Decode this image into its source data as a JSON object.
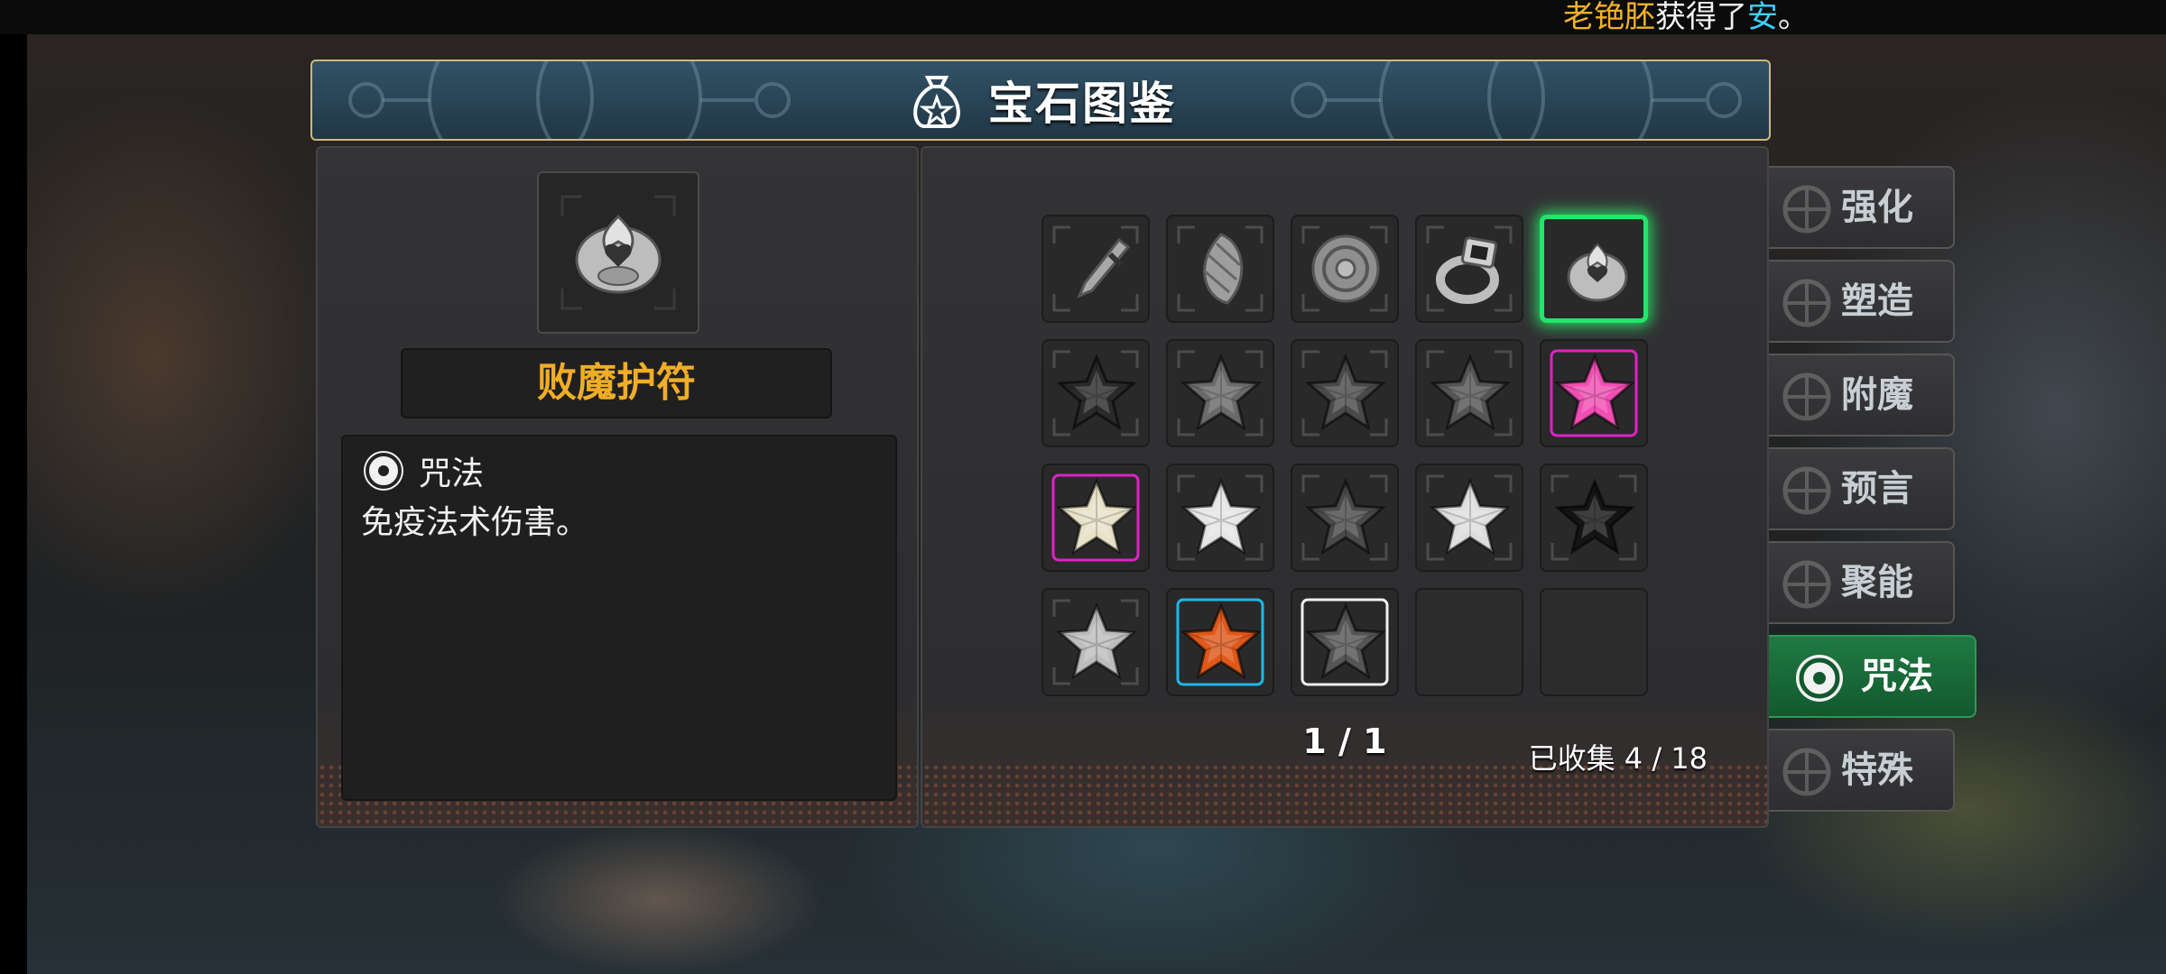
{
  "notice": {
    "player": "老铯胚",
    "action": "获得了",
    "item": "安",
    "end": "。"
  },
  "header": {
    "title": "宝石图鉴",
    "icon": "bag-star-icon"
  },
  "detail": {
    "name": "败魔护符",
    "type": "咒法",
    "type_icon": "spiral-icon",
    "description": "免疫法术伤害。"
  },
  "grid": {
    "page": "1 / 1",
    "collected": "已收集 4 / 18",
    "slots": [
      {
        "icon": "dagger-icon",
        "state": "owned"
      },
      {
        "icon": "scale-icon",
        "state": "owned"
      },
      {
        "icon": "shield-icon",
        "state": "owned"
      },
      {
        "icon": "ring-icon",
        "state": "owned"
      },
      {
        "icon": "amulet-icon",
        "state": "selected"
      },
      {
        "icon": "star-gem-icon",
        "color": "#2a2a2a",
        "frame": "#555555"
      },
      {
        "icon": "star-gem-icon",
        "color": "#6a6a6a",
        "frame": "#555555"
      },
      {
        "icon": "star-gem-icon",
        "color": "#4a4a4a",
        "frame": "#555555"
      },
      {
        "icon": "star-gem-icon",
        "color": "#555555",
        "frame": "#555555"
      },
      {
        "icon": "star-gem-icon",
        "color": "#f14fb4",
        "frame": "#e021c8"
      },
      {
        "icon": "star-gem-icon",
        "color": "#e8e2c8",
        "frame": "#e021c8"
      },
      {
        "icon": "star-gem-icon",
        "color": "#e6e6e6",
        "frame": "#555555"
      },
      {
        "icon": "star-gem-icon",
        "color": "#4a4a4a",
        "frame": "#555555"
      },
      {
        "icon": "star-gem-icon",
        "color": "#dedede",
        "frame": "#555555"
      },
      {
        "icon": "star-gem-icon",
        "color": "#151515",
        "frame": "#555555"
      },
      {
        "icon": "star-gem-icon",
        "color": "#bdbdbd",
        "frame": "#555555"
      },
      {
        "icon": "star-gem-icon",
        "color": "#e0581a",
        "frame": "#20b6e8"
      },
      {
        "icon": "star-gem-icon",
        "color": "#555555",
        "frame": "#f0f0f0"
      },
      {
        "icon": "",
        "state": "empty"
      },
      {
        "icon": "",
        "state": "empty"
      }
    ]
  },
  "tabs": [
    {
      "label": "强化",
      "icon": "strengthen-icon",
      "active": false
    },
    {
      "label": "塑造",
      "icon": "forge-icon",
      "active": false
    },
    {
      "label": "附魔",
      "icon": "enchant-icon",
      "active": false
    },
    {
      "label": "预言",
      "icon": "prophecy-icon",
      "active": false
    },
    {
      "label": "聚能",
      "icon": "energy-icon",
      "active": false
    },
    {
      "label": "咒法",
      "icon": "spiral-icon",
      "active": true
    },
    {
      "label": "特殊",
      "icon": "special-icon",
      "active": false
    }
  ],
  "colors": {
    "accent_gold": "#f0ad27",
    "active_tab": "#1f7a42",
    "selected_glow": "#22e66a"
  }
}
